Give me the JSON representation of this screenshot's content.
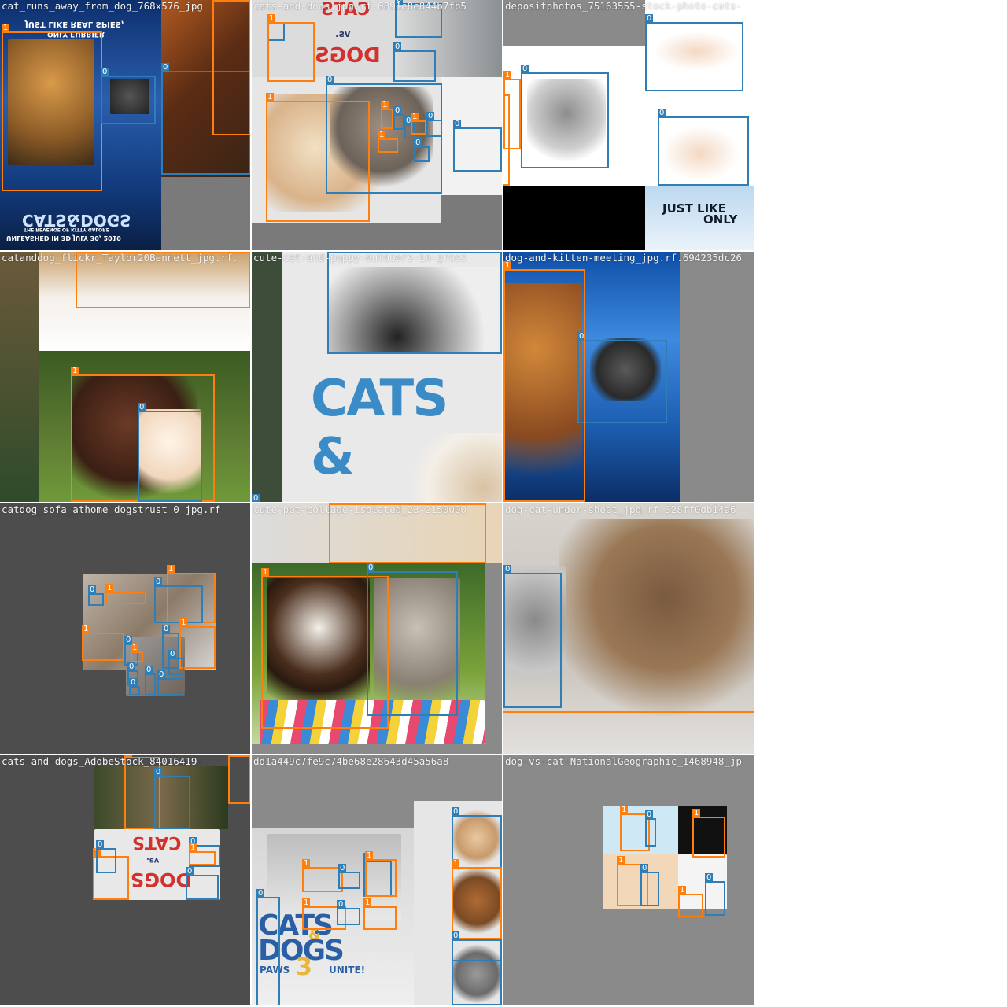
{
  "colors": {
    "class0": "#2f7fb6",
    "class1": "#ff7f0e",
    "title_text": "#f2f2f2",
    "empty_bg": "#7a7a7a"
  },
  "tiles": [
    {
      "title": "cat_runs_away_from_dog_768x576_jpg",
      "poster_lines": [
        "JUST LIKE REAL SPIES,",
        "ONLY FURRIER",
        "CATS&DOGS",
        "THE REVENGE OF KITTY GALORE",
        "UNLEASHED IN 3D JULY 30, 2010"
      ],
      "labels": [
        "1",
        "0",
        "0",
        "1"
      ]
    },
    {
      "title": "cats-and-dogs_jpg.rf.6891e8e844b7fb5",
      "poster_lines": [
        "CATS",
        "vs.",
        "DOGS"
      ],
      "labels": [
        "0",
        "0",
        "1",
        "0",
        "1",
        "0",
        "1",
        "0",
        "1",
        "0",
        "0",
        "1",
        "0",
        "0"
      ]
    },
    {
      "title": "depositphotos_75163555-stock-photo-cats-",
      "poster_lines": [
        "JUST LIKE",
        "ONLY"
      ],
      "labels": [
        "0",
        "0",
        "0",
        "1",
        "1"
      ]
    },
    {
      "title": "catanddog_flickr_Taylor20Bennett_jpg.rf.",
      "labels": [
        "1",
        "1",
        "0"
      ]
    },
    {
      "title": "cute-cat-and-puppy-outdoors-in-grass",
      "poster_lines": [
        "CATS &"
      ],
      "labels": [
        "0",
        "0"
      ]
    },
    {
      "title": "dog-and-kitten-meeting_jpg.rf.694235dc26",
      "labels": [
        "0",
        "1"
      ]
    },
    {
      "title": "catdog_sofa_athome_dogstrust_0_jpg.rf",
      "labels": [
        "1",
        "0",
        "1",
        "0",
        "1",
        "0",
        "1",
        "0",
        "1",
        "0",
        "0",
        "0",
        "0",
        "0"
      ]
    },
    {
      "title": "cute-pet-collage-isolated_23-2150000",
      "labels": [
        "1",
        "1",
        "0"
      ]
    },
    {
      "title": "dog-cat-under-sheet_jpg.rf.328ff0db14a6",
      "labels": [
        "0"
      ]
    },
    {
      "title": "cats-and-dogs_AdobeStock_84016419-",
      "poster_lines": [
        "CATS",
        "vs.",
        "DOGS"
      ],
      "labels": [
        "1",
        "0",
        "1",
        "1",
        "0",
        "0",
        "0",
        "1"
      ]
    },
    {
      "title": "dd1a449c7fe9c74be68e28643d45a56a8",
      "poster_lines": [
        "CATS",
        "&",
        "DOGS",
        "PAWS",
        "3",
        "UNITE!"
      ],
      "labels": [
        "0",
        "1",
        "0",
        "1",
        "0",
        "0",
        "1",
        "1",
        "1",
        "0",
        "0",
        "0"
      ]
    },
    {
      "title": "dog-vs-cat-NationalGeographic_1468948_jp",
      "labels": [
        "1",
        "0",
        "1",
        "1",
        "0",
        "1",
        "0"
      ]
    }
  ]
}
